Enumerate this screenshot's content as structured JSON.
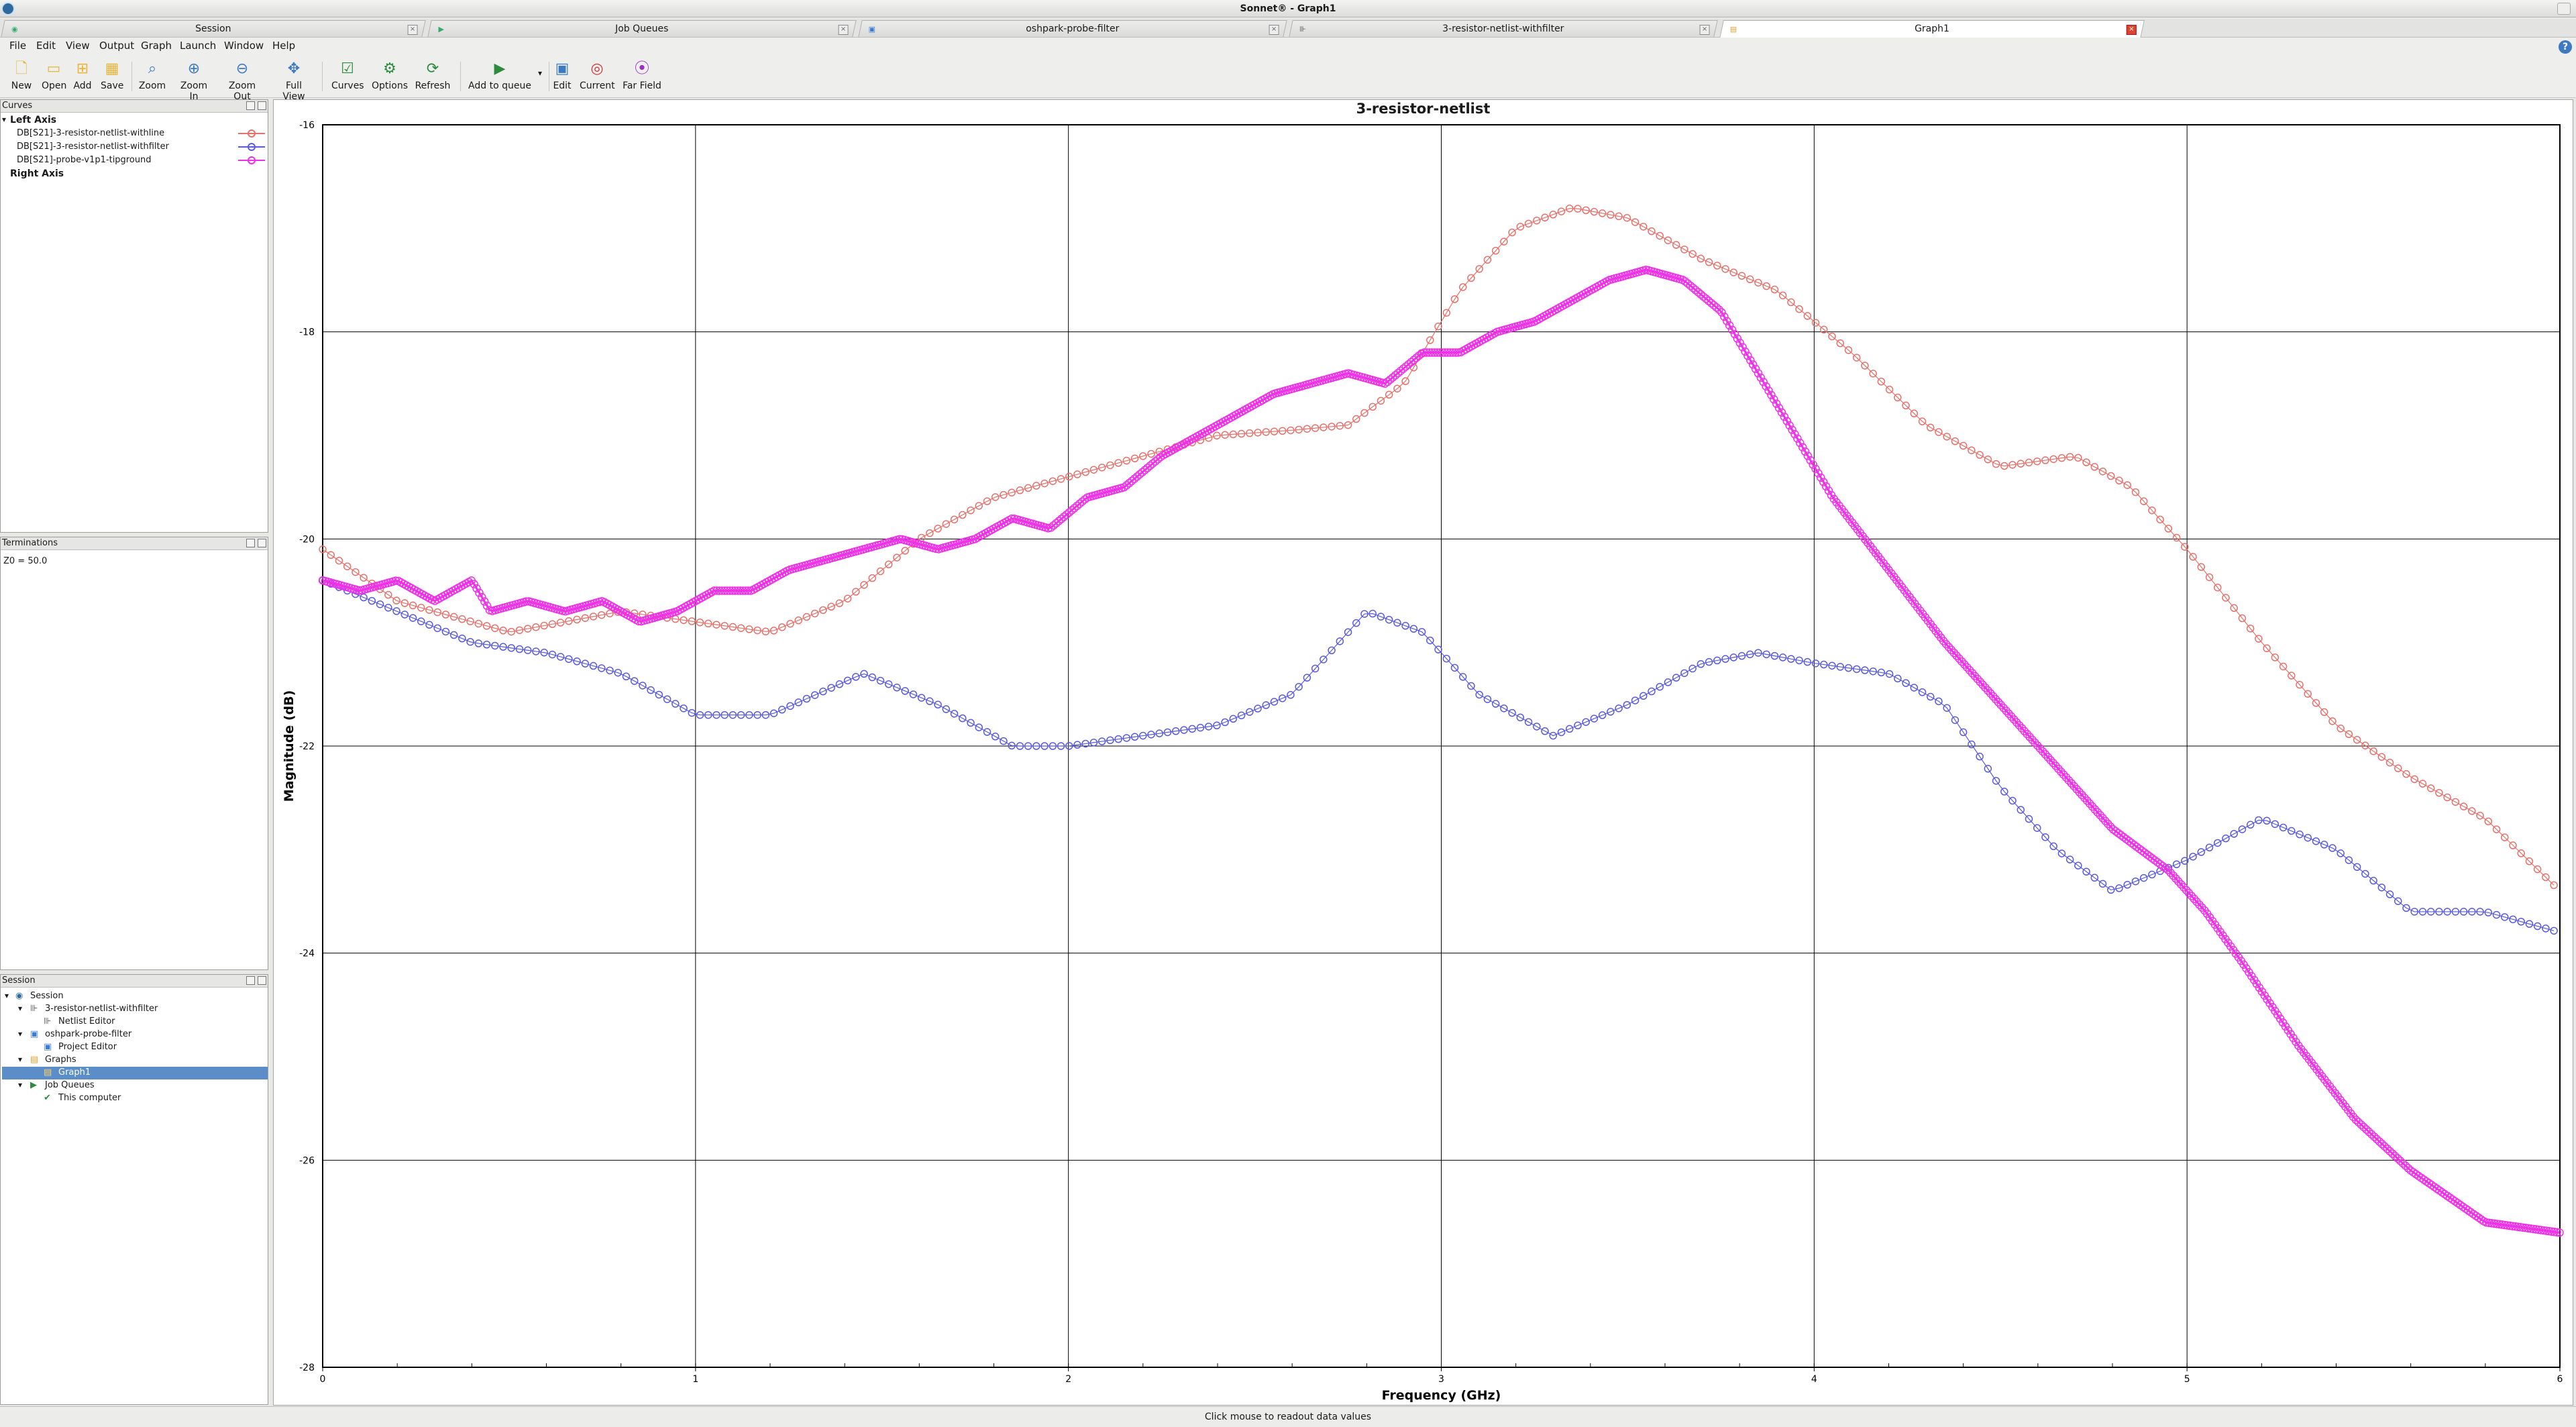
{
  "window": {
    "title": "Sonnet® - Graph1"
  },
  "tabs": [
    {
      "label": "Session"
    },
    {
      "label": "Job Queues"
    },
    {
      "label": "oshpark-probe-filter"
    },
    {
      "label": "3-resistor-netlist-withfilter"
    },
    {
      "label": "Graph1"
    }
  ],
  "menu": [
    "File",
    "Edit",
    "View",
    "Output",
    "Graph",
    "Launch",
    "Window",
    "Help"
  ],
  "toolbar": [
    {
      "label": "New",
      "icon": "new-file-icon"
    },
    {
      "label": "Open",
      "icon": "open-folder-icon"
    },
    {
      "label": "Add",
      "icon": "add-icon"
    },
    {
      "label": "Save",
      "icon": "save-icon"
    },
    {
      "label": "Zoom",
      "icon": "zoom-icon"
    },
    {
      "label": "Zoom In",
      "icon": "zoom-in-icon"
    },
    {
      "label": "Zoom Out",
      "icon": "zoom-out-icon"
    },
    {
      "label": "Full View",
      "icon": "full-view-icon"
    },
    {
      "label": "Curves",
      "icon": "curves-icon"
    },
    {
      "label": "Options",
      "icon": "options-gear-icon"
    },
    {
      "label": "Refresh",
      "icon": "refresh-icon"
    },
    {
      "label": "Add to queue",
      "icon": "add-to-queue-icon"
    },
    {
      "label": "Edit",
      "icon": "edit-icon"
    },
    {
      "label": "Current",
      "icon": "current-icon"
    },
    {
      "label": "Far Field",
      "icon": "far-field-icon"
    }
  ],
  "curves_panel": {
    "title": "Curves",
    "left_axis": "Left Axis",
    "right_axis": "Right Axis",
    "items": [
      {
        "label": "DB[S21]-3-resistor-netlist-withline",
        "color": "#e8706a"
      },
      {
        "label": "DB[S21]-3-resistor-netlist-withfilter",
        "color": "#5a5ae0"
      },
      {
        "label": "DB[S21]-probe-v1p1-tipground",
        "color": "#f030e8"
      }
    ]
  },
  "terminations_panel": {
    "title": "Terminations",
    "text": "Z0 = 50.0"
  },
  "session_panel": {
    "title": "Session",
    "tree": [
      {
        "label": "Session"
      },
      {
        "label": "3-resistor-netlist-withfilter"
      },
      {
        "label": "Netlist Editor"
      },
      {
        "label": "oshpark-probe-filter"
      },
      {
        "label": "Project Editor"
      },
      {
        "label": "Graphs"
      },
      {
        "label": "Graph1"
      },
      {
        "label": "Job Queues"
      },
      {
        "label": "This computer"
      }
    ]
  },
  "status": "Click mouse to readout data values",
  "chart_data": {
    "type": "scatter",
    "title": "3-resistor-netlist",
    "xlabel": "Frequency (GHz)",
    "ylabel": "Magnitude (dB)",
    "xlim": [
      0,
      6
    ],
    "ylim": [
      -28,
      -16
    ],
    "xticks": [
      "0",
      "1",
      "2",
      "3",
      "4",
      "5",
      "6"
    ],
    "yticks": [
      "-16",
      "-18",
      "-20",
      "-22",
      "-24",
      "-26",
      "-28"
    ],
    "grid": true,
    "series": [
      {
        "name": "DB[S21]-3-resistor-netlist-withline",
        "color": "#e8706a",
        "x": [
          0,
          0.2,
          0.5,
          0.8,
          1.0,
          1.2,
          1.4,
          1.6,
          1.8,
          2.0,
          2.2,
          2.4,
          2.6,
          2.75,
          2.9,
          3.05,
          3.2,
          3.35,
          3.5,
          3.7,
          3.9,
          4.1,
          4.3,
          4.5,
          4.7,
          4.85,
          5.0,
          5.2,
          5.4,
          5.6,
          5.8,
          6.0
        ],
        "y": [
          -20.1,
          -20.6,
          -20.9,
          -20.7,
          -20.8,
          -20.9,
          -20.6,
          -20.0,
          -19.6,
          -19.4,
          -19.2,
          -19.0,
          -18.95,
          -18.9,
          -18.5,
          -17.6,
          -17.0,
          -16.8,
          -16.9,
          -17.3,
          -17.6,
          -18.2,
          -18.9,
          -19.3,
          -19.2,
          -19.5,
          -20.1,
          -21.0,
          -21.8,
          -22.3,
          -22.7,
          -23.4
        ]
      },
      {
        "name": "DB[S21]-3-resistor-netlist-withfilter",
        "color": "#5a5ae0",
        "x": [
          0,
          0.2,
          0.4,
          0.6,
          0.8,
          1.0,
          1.2,
          1.45,
          1.65,
          1.85,
          2.0,
          2.2,
          2.4,
          2.6,
          2.8,
          2.95,
          3.1,
          3.3,
          3.5,
          3.7,
          3.85,
          4.0,
          4.2,
          4.35,
          4.5,
          4.65,
          4.8,
          5.0,
          5.2,
          5.4,
          5.6,
          5.8,
          6.0
        ],
        "y": [
          -20.4,
          -20.7,
          -21.0,
          -21.1,
          -21.3,
          -21.7,
          -21.7,
          -21.3,
          -21.6,
          -22.0,
          -22.0,
          -21.9,
          -21.8,
          -21.5,
          -20.7,
          -20.9,
          -21.5,
          -21.9,
          -21.6,
          -21.2,
          -21.1,
          -21.2,
          -21.3,
          -21.6,
          -22.4,
          -23.0,
          -23.4,
          -23.1,
          -22.7,
          -23.0,
          -23.6,
          -23.6,
          -23.8
        ]
      },
      {
        "name": "DB[S21]-probe-v1p1-tipground",
        "color": "#f030e8",
        "x": [
          0,
          0.1,
          0.2,
          0.3,
          0.4,
          0.45,
          0.55,
          0.65,
          0.75,
          0.85,
          0.95,
          1.05,
          1.15,
          1.25,
          1.35,
          1.45,
          1.55,
          1.65,
          1.75,
          1.85,
          1.95,
          2.05,
          2.15,
          2.25,
          2.35,
          2.45,
          2.55,
          2.65,
          2.75,
          2.85,
          2.95,
          3.05,
          3.15,
          3.25,
          3.35,
          3.45,
          3.55,
          3.65,
          3.75,
          3.85,
          3.95,
          4.05,
          4.2,
          4.35,
          4.5,
          4.65,
          4.8,
          4.95,
          5.05,
          5.15,
          5.3,
          5.45,
          5.6,
          5.8,
          6.0
        ],
        "y": [
          -20.4,
          -20.5,
          -20.4,
          -20.6,
          -20.4,
          -20.7,
          -20.6,
          -20.7,
          -20.6,
          -20.8,
          -20.7,
          -20.5,
          -20.5,
          -20.3,
          -20.2,
          -20.1,
          -20.0,
          -20.1,
          -20.0,
          -19.8,
          -19.9,
          -19.6,
          -19.5,
          -19.2,
          -19.0,
          -18.8,
          -18.6,
          -18.5,
          -18.4,
          -18.5,
          -18.2,
          -18.2,
          -18.0,
          -17.9,
          -17.7,
          -17.5,
          -17.4,
          -17.5,
          -17.8,
          -18.4,
          -19.0,
          -19.6,
          -20.3,
          -21.0,
          -21.6,
          -22.2,
          -22.8,
          -23.2,
          -23.6,
          -24.1,
          -24.9,
          -25.6,
          -26.1,
          -26.6,
          -26.7
        ]
      }
    ]
  }
}
